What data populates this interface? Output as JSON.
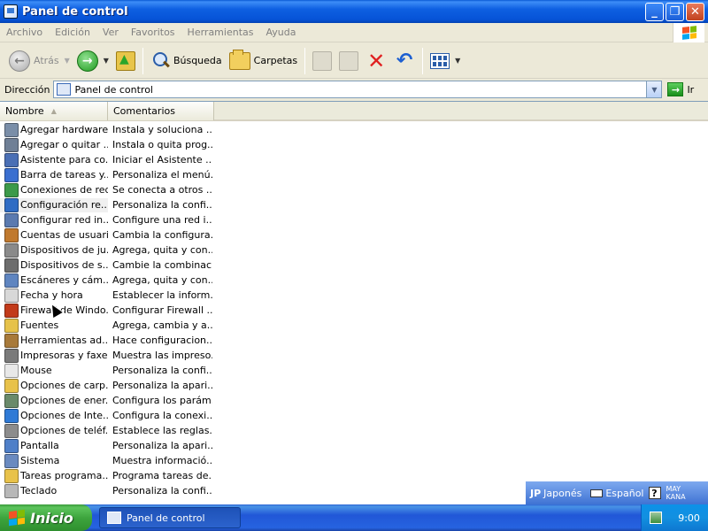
{
  "window": {
    "title": "Panel de control"
  },
  "menu": [
    "Archivo",
    "Edición",
    "Ver",
    "Favoritos",
    "Herramientas",
    "Ayuda"
  ],
  "toolbar": {
    "back_label": "Atrás",
    "search_label": "Búsqueda",
    "folders_label": "Carpetas"
  },
  "address": {
    "label": "Dirección",
    "value": "Panel de control",
    "go_label": "Ir"
  },
  "columns": {
    "name": "Nombre",
    "comments": "Comentarios"
  },
  "items": [
    {
      "name": "Agregar hardware",
      "comment": "Instala y soluciona ...",
      "icon": "hardware-icon",
      "color": "#7a8ea8"
    },
    {
      "name": "Agregar o quitar ...",
      "comment": "Instala o quita prog...",
      "icon": "add-remove-programs-icon",
      "color": "#6f7f96"
    },
    {
      "name": "Asistente para co...",
      "comment": "Iniciar el Asistente ...",
      "icon": "network-wizard-icon",
      "color": "#4a6fb5"
    },
    {
      "name": "Barra de tareas y...",
      "comment": "Personaliza el menú...",
      "icon": "taskbar-icon",
      "color": "#3a6fd0"
    },
    {
      "name": "Conexiones de red",
      "comment": "Se conecta a otros ...",
      "icon": "network-connections-icon",
      "color": "#3c9a4a"
    },
    {
      "name": "Configuración re...",
      "comment": "Personaliza la confi...",
      "icon": "regional-settings-icon",
      "color": "#2f6cc4"
    },
    {
      "name": "Configurar red in...",
      "comment": "Configure una red i...",
      "icon": "wireless-network-icon",
      "color": "#5a7ab0"
    },
    {
      "name": "Cuentas de usuario",
      "comment": "Cambia la configura...",
      "icon": "user-accounts-icon",
      "color": "#c0792e"
    },
    {
      "name": "Dispositivos de ju...",
      "comment": "Agrega, quita y con...",
      "icon": "game-controllers-icon",
      "color": "#8a8a8a"
    },
    {
      "name": "Dispositivos de s...",
      "comment": "Cambie la combinaci...",
      "icon": "sound-devices-icon",
      "color": "#6d6d6d"
    },
    {
      "name": "Escáneres y cám...",
      "comment": "Agrega, quita y con...",
      "icon": "scanners-cameras-icon",
      "color": "#5f85c0"
    },
    {
      "name": "Fecha y hora",
      "comment": "Establecer la inform...",
      "icon": "date-time-icon",
      "color": "#d8d8d8"
    },
    {
      "name": "Firewall de Windo...",
      "comment": "Configurar Firewall ...",
      "icon": "firewall-icon",
      "color": "#c23a1a"
    },
    {
      "name": "Fuentes",
      "comment": "Agrega, cambia y a...",
      "icon": "fonts-icon",
      "color": "#e6c24a"
    },
    {
      "name": "Herramientas ad...",
      "comment": "Hace configuracion...",
      "icon": "admin-tools-icon",
      "color": "#a87a3a"
    },
    {
      "name": "Impresoras y faxes",
      "comment": "Muestra las impreso...",
      "icon": "printers-faxes-icon",
      "color": "#7a7a7a"
    },
    {
      "name": "Mouse",
      "comment": "Personaliza la confi...",
      "icon": "mouse-icon",
      "color": "#e8e8e8"
    },
    {
      "name": "Opciones de carp...",
      "comment": "Personaliza la apari...",
      "icon": "folder-options-icon",
      "color": "#e8c24a"
    },
    {
      "name": "Opciones de ener...",
      "comment": "Configura los parám...",
      "icon": "power-options-icon",
      "color": "#6a8a6a"
    },
    {
      "name": "Opciones de Inte...",
      "comment": "Configura la conexi...",
      "icon": "internet-options-icon",
      "color": "#2f7ad6"
    },
    {
      "name": "Opciones de teléf...",
      "comment": "Establece las reglas...",
      "icon": "phone-modem-icon",
      "color": "#8c8c8c"
    },
    {
      "name": "Pantalla",
      "comment": "Personaliza la apari...",
      "icon": "display-icon",
      "color": "#4f7fc8"
    },
    {
      "name": "Sistema",
      "comment": "Muestra informació...",
      "icon": "system-icon",
      "color": "#6a8ac0"
    },
    {
      "name": "Tareas programa...",
      "comment": "Programa tareas de...",
      "icon": "scheduled-tasks-icon",
      "color": "#e8c24a"
    },
    {
      "name": "Teclado",
      "comment": "Personaliza la confi...",
      "icon": "keyboard-icon",
      "color": "#b8b8b8"
    }
  ],
  "language_bar": {
    "lang_code": "JP",
    "lang_name": "Japonés",
    "keyboard": "Español",
    "mode_top": "MAY",
    "mode_bottom": "KANA"
  },
  "taskbar": {
    "start_label": "Inicio",
    "task_label": "Panel de control",
    "clock": "9:00"
  }
}
